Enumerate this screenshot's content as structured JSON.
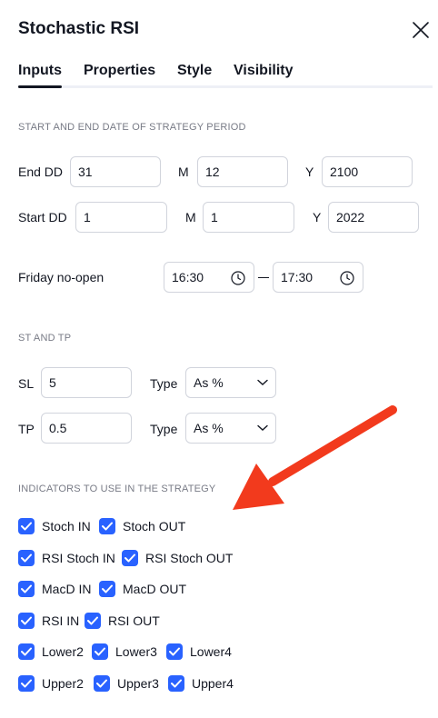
{
  "dialog": {
    "title": "Stochastic RSI",
    "tabs": [
      {
        "label": "Inputs",
        "active": true
      },
      {
        "label": "Properties",
        "active": false
      },
      {
        "label": "Style",
        "active": false
      },
      {
        "label": "Visibility",
        "active": false
      }
    ]
  },
  "date_section": {
    "heading": "START AND END DATE OF STRATEGY PERIOD",
    "end": {
      "label": "End DD",
      "dd": "31",
      "m_label": "M",
      "m": "12",
      "y_label": "Y",
      "y": "2100"
    },
    "start": {
      "label": "Start DD",
      "dd": "1",
      "m_label": "M",
      "m": "1",
      "y_label": "Y",
      "y": "2022"
    },
    "friday": {
      "label": "Friday no-open",
      "from": "16:30",
      "to": "17:30"
    }
  },
  "st_tp": {
    "heading": "ST AND TP",
    "sl": {
      "label": "SL",
      "value": "5",
      "type_label": "Type",
      "type_value": "As %"
    },
    "tp": {
      "label": "TP",
      "value": "0.5",
      "type_label": "Type",
      "type_value": "As %"
    }
  },
  "indicators": {
    "heading": "INDICATORS TO USE IN THE STRATEGY",
    "rows": [
      [
        {
          "label": "Stoch IN",
          "checked": true
        },
        {
          "label": "Stoch OUT",
          "checked": true
        }
      ],
      [
        {
          "label": "RSI Stoch IN",
          "checked": true
        },
        {
          "label": "RSI Stoch OUT",
          "checked": true
        }
      ],
      [
        {
          "label": "MacD IN",
          "checked": true
        },
        {
          "label": "MacD OUT",
          "checked": true
        }
      ],
      [
        {
          "label": "RSI IN",
          "checked": true
        },
        {
          "label": "RSI OUT",
          "checked": true
        }
      ],
      [
        {
          "label": "Lower2",
          "checked": true
        },
        {
          "label": "Lower3",
          "checked": true
        },
        {
          "label": "Lower4",
          "checked": true
        }
      ],
      [
        {
          "label": "Upper2",
          "checked": true
        },
        {
          "label": "Upper3",
          "checked": true
        },
        {
          "label": "Upper4",
          "checked": true
        }
      ]
    ]
  },
  "colors": {
    "accent": "#2962ff",
    "annotation_arrow": "#f23a1d",
    "text": "#131722",
    "muted": "#787b86",
    "border": "#d1d4dc"
  }
}
